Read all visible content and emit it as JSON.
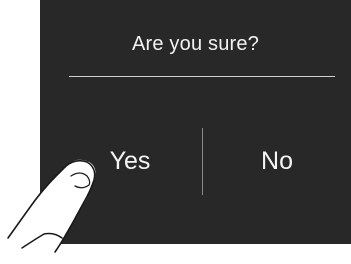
{
  "dialog": {
    "title": "Are you sure?",
    "yes_label": "Yes",
    "no_label": "No"
  },
  "colors": {
    "dialog_background": "#282828",
    "text": "#f2f2f2",
    "divider": "#cfcfcf"
  },
  "icons": {
    "pointer": "finger-tap-icon"
  }
}
